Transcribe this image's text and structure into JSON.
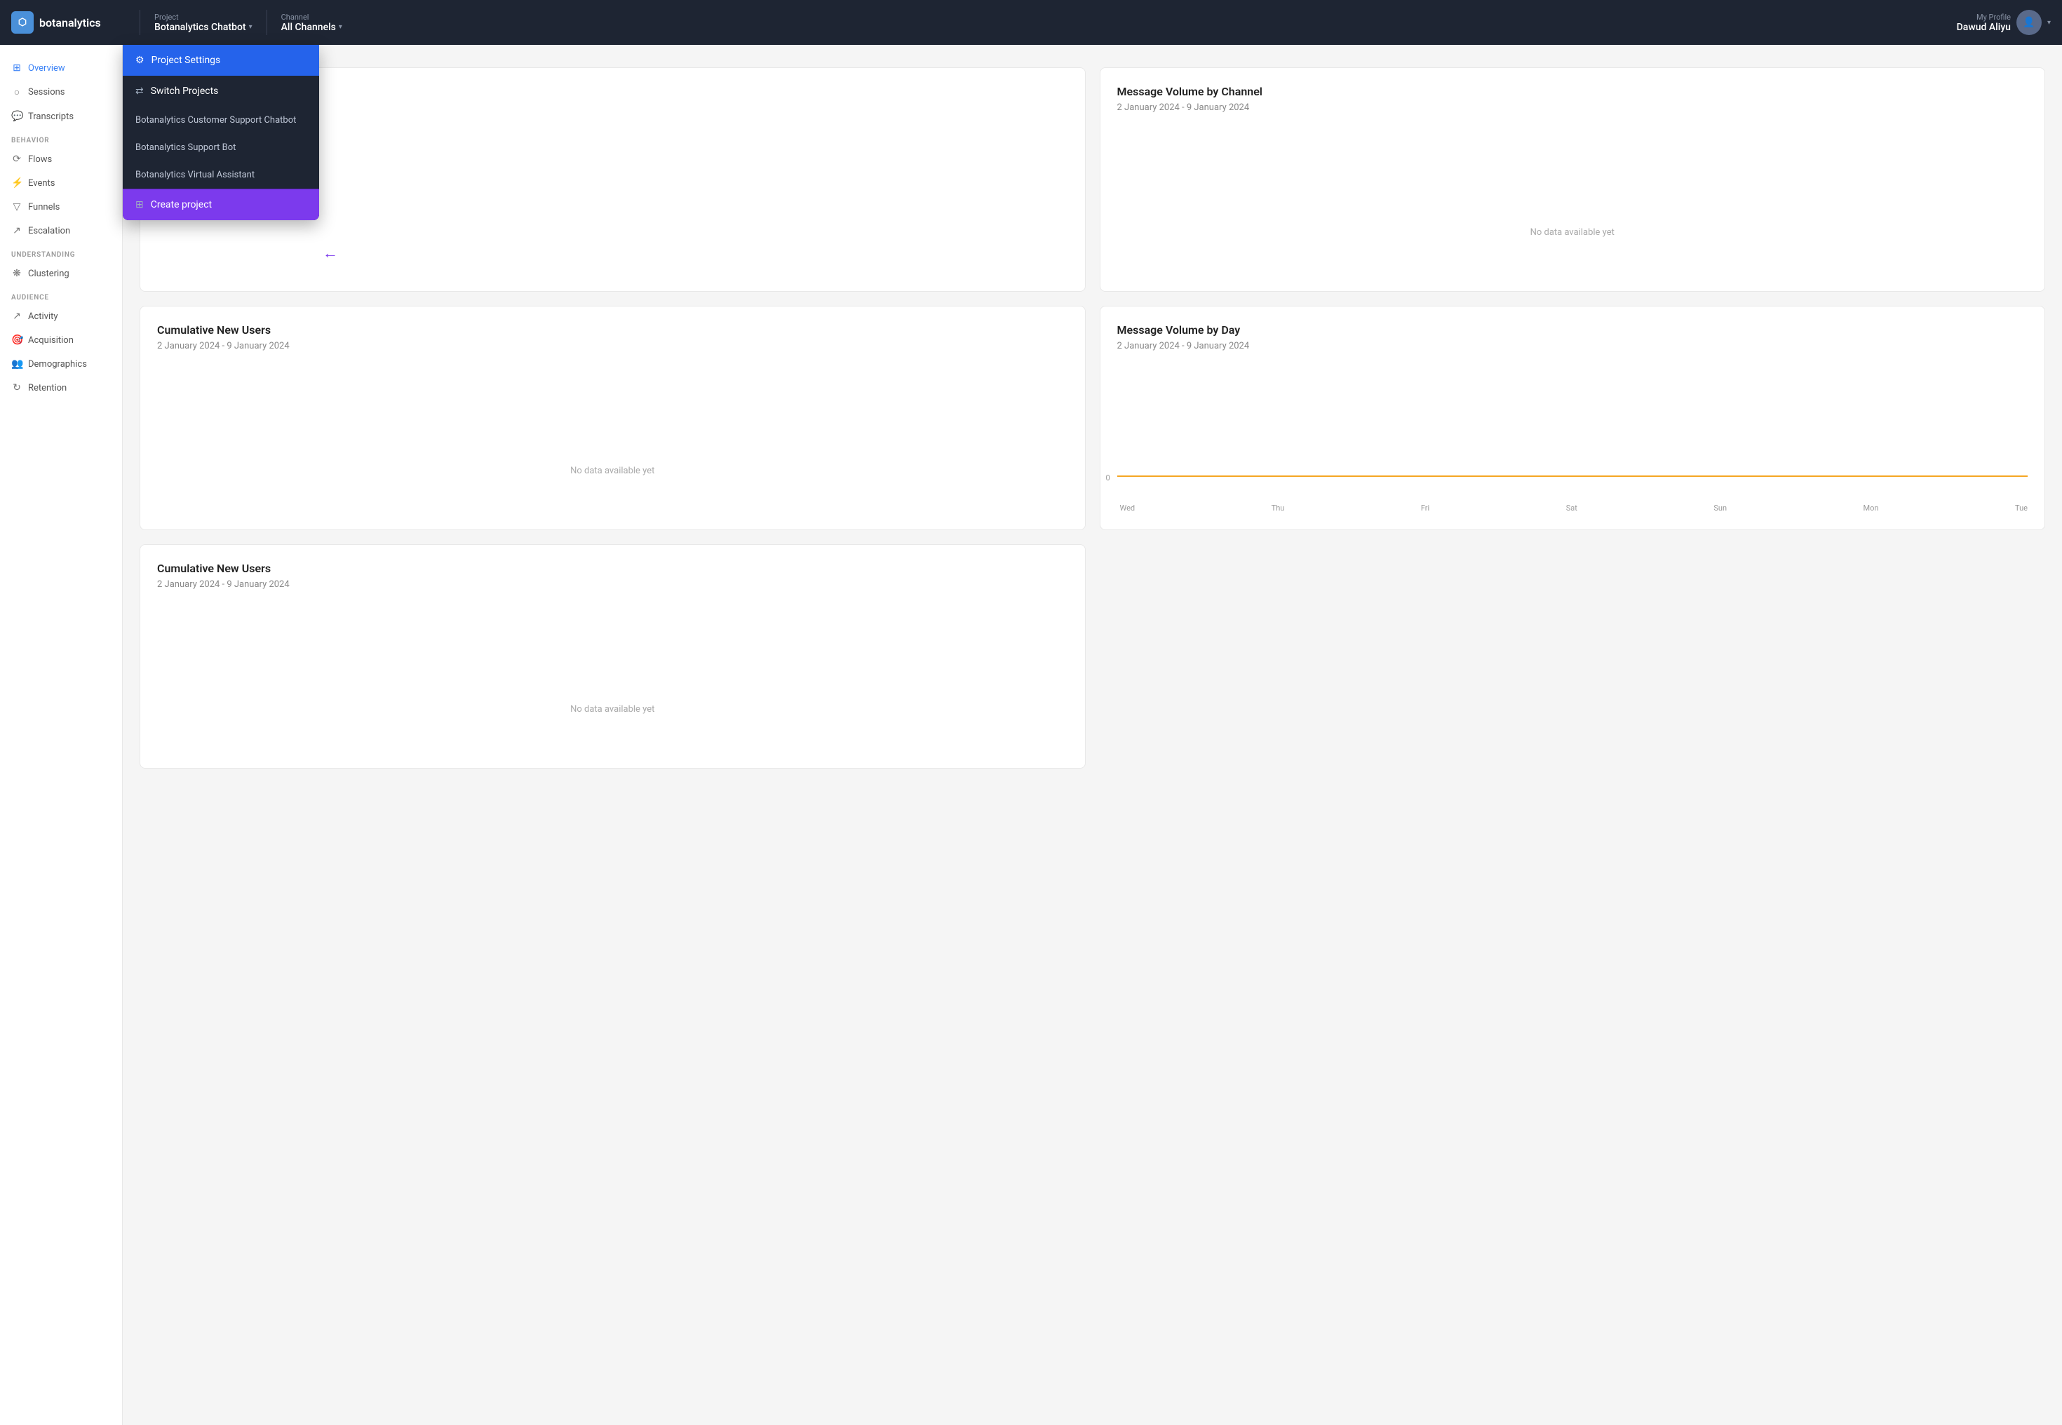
{
  "app": {
    "name": "botanalytics"
  },
  "header": {
    "project_label": "Project",
    "project_value": "Botanalytics Chatbot",
    "channel_label": "Channel",
    "channel_value": "All Channels",
    "profile_label": "My Profile",
    "profile_name": "Dawud Aliyu"
  },
  "sidebar": {
    "overview_label": "Overview",
    "sessions_label": "Sessions",
    "transcripts_label": "Transcripts",
    "behavior_label": "BEHAVIOR",
    "flows_label": "Flows",
    "events_label": "Events",
    "funnels_label": "Funnels",
    "escalation_label": "Escalation",
    "understanding_label": "UNDERSTANDING",
    "clustering_label": "Clustering",
    "audience_label": "AUDIENCE",
    "activity_label": "Activity",
    "acquisition_label": "Acquisition",
    "demographics_label": "Demographics",
    "retention_label": "Retention"
  },
  "dropdown": {
    "project_settings_label": "Project Settings",
    "switch_projects_label": "Switch Projects",
    "projects": [
      "Botanalytics Customer Support Chatbot",
      "Botanalytics Support Bot",
      "Botanalytics Virtual Assistant"
    ],
    "create_project_label": "Create project"
  },
  "cards": {
    "card1": {
      "title": "Message Volume by Channel",
      "subtitle": "2 January 2024 - 9 January 2024",
      "no_data": "No data available yet"
    },
    "card2": {
      "title": "Cumulative New Users",
      "subtitle": "2 January 2024 - 9 January 2024",
      "no_data": "No data available yet"
    },
    "card3": {
      "title": "Message Volume by Day",
      "subtitle": "2 January 2024 - 9 January 2024",
      "zero_label": "0",
      "x_labels": [
        "Wed",
        "Thu",
        "Fri",
        "Sat",
        "Sun",
        "Mon",
        "Tue"
      ]
    }
  }
}
